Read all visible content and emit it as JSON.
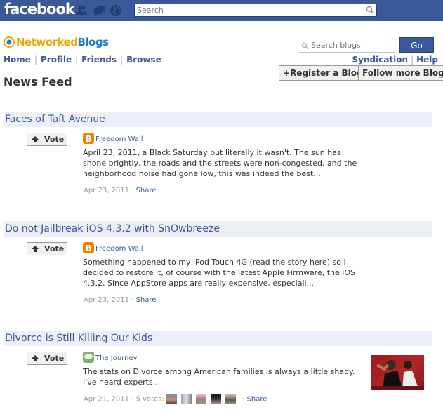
{
  "facebook_bar": {
    "logo": "facebook",
    "icons": [
      "friends-icon",
      "messages-icon",
      "notifications-icon"
    ],
    "search_placeholder": "Search",
    "bar_color": "#3b5998"
  },
  "app": {
    "logo_part1": "Networked",
    "logo_part2": "Blogs",
    "nav": [
      "Home",
      "Profile",
      "Friends",
      "Browse"
    ],
    "search_blogs_placeholder": "Search blogs",
    "go_label": "Go",
    "top_links": [
      "Syndication",
      "Help"
    ],
    "register_label": "Register a Blog",
    "follow_label": "Follow more Blogs",
    "page_title": "News Feed"
  },
  "posts": [
    {
      "title": "Faces of Taft Avenue",
      "vote_label": "Vote",
      "source": "Freedom Wall",
      "source_icon": "blogger-icon",
      "excerpt": "April 23, 2011, a Black Saturday but literally it wasn't. The sun has shone brightly, the roads and the streets were non-congested, and the neighborhood noise had gone low, this was indeed the best...",
      "date": "Apr 23, 2011",
      "share": "Share"
    },
    {
      "title": "Do not Jailbreak iOS 4.3.2 with SnOwbreeze",
      "vote_label": "Vote",
      "source": "Freedom Wall",
      "source_icon": "blogger-icon",
      "excerpt": "Something happened to my iPod Touch 4G (read the story here) so I decided to restore it, of course with the latest Apple Firmware, the iOS 4.3.2. Since AppStore apps are really expensive, especiall...",
      "date": "Apr 23, 2011",
      "share": "Share"
    },
    {
      "title": "Divorce is Still Killing Our Kids",
      "vote_label": "Vote",
      "source": "The Journey",
      "source_icon": "speech-bubble-icon",
      "excerpt": "The stats on Divorce among American families is always a little shady. I've heard experts...",
      "date": "Apr 21, 2011",
      "votes": "5 votes:",
      "voter_count": 5,
      "share": "Share"
    }
  ]
}
